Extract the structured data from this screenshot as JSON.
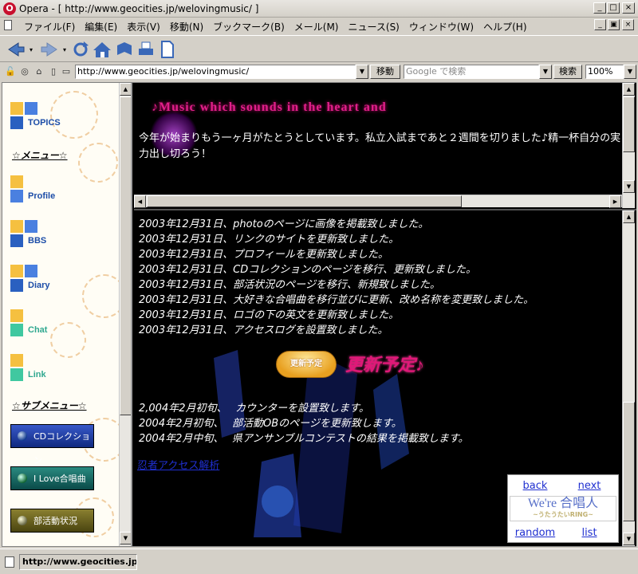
{
  "window": {
    "title": "Opera - [ http://www.geocities.jp/welovingmusic/ ]",
    "logo": "O",
    "minimize_icon": "_",
    "maximize_icon": "□",
    "close_icon": "×"
  },
  "menu": {
    "items": [
      "ファイル(F)",
      "編集(E)",
      "表示(V)",
      "移動(N)",
      "ブックマーク(B)",
      "メール(M)",
      "ニュース(S)",
      "ウィンドウ(W)",
      "ヘルプ(H)"
    ]
  },
  "address": {
    "url": "http://www.geocities.jp/welovingmusic/",
    "go_label": "移動",
    "search_placeholder": "Google で検索",
    "search_label": "検索",
    "zoom": "100%"
  },
  "left_frame": {
    "nav": [
      "TOPICS",
      "Profile",
      "BBS",
      "Diary",
      "Chat",
      "Link"
    ],
    "menu_heading": "☆メニュー☆",
    "submenu_heading": "☆サブメニュー☆",
    "pills": [
      "CDコレクション",
      "I Love合唱曲",
      "部活動状況"
    ]
  },
  "top_frame": {
    "banner": "♪Music which sounds in the heart and",
    "intro": "今年が始まりもう一ヶ月がたとうとしています。私立入試まであと２週間を切りました♪精一杯自分の実力出し切ろう！"
  },
  "main_frame": {
    "updates": [
      "2003年12月31日、photoのページに画像を掲載致しました。",
      "2003年12月31日、リンクのサイトを更新致しました。",
      "2003年12月31日、プロフィールを更新致しました。",
      "2003年12月31日、CDコレクションのページを移行、更新致しました。",
      "2003年12月31日、部活状況のページを移行、新規致しました。",
      "2003年12月31日、大好きな合唱曲を移行並びに更新、改め名称を変更致しました。",
      "2003年12月31日、ロゴの下の英文を更新致しました。",
      "2003年12月31日、アクセスログを設置致しました。"
    ],
    "plan_button": "更新予定",
    "plan_heading": "更新予定♪",
    "plans": [
      "2,004年2月初旬、　 カウンターを設置致します。",
      "2004年2月初旬、　 部活動OBのページを更新致します。",
      "2004年2月中旬、　 県アンサンブルコンテストの結果を掲載致します。"
    ],
    "access_link": "忍者アクセス解析",
    "ring": {
      "back": "back",
      "next": "next",
      "logo_line1": "We're 合唱人",
      "logo_line2": "~うたうたいRING~",
      "random": "random",
      "list": "list"
    }
  },
  "status": {
    "text": "http://www.geocities.jp/welovingmusic/"
  }
}
